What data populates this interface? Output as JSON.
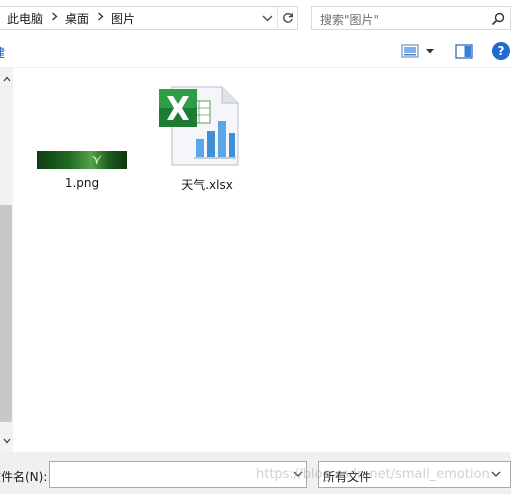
{
  "breadcrumb": {
    "items": [
      "此电脑",
      "桌面",
      "图片"
    ]
  },
  "search": {
    "placeholder": "搜索\"图片\""
  },
  "toolbar": {
    "left_partial": "建"
  },
  "files": [
    {
      "name": "1.png",
      "icon": "image-thumbnail"
    },
    {
      "name": "天气.xlsx",
      "icon": "excel-file-icon"
    }
  ],
  "bottom": {
    "filename_label": "文件名(N):",
    "filename_value": "",
    "filetype_value": "所有文件"
  },
  "watermark": "https://blog.csdn.net/small_emotion",
  "colors": {
    "accent": "#1f6bd0",
    "scroll_thumb": "#c8c8c8",
    "excel_green": "#1e7b34"
  }
}
